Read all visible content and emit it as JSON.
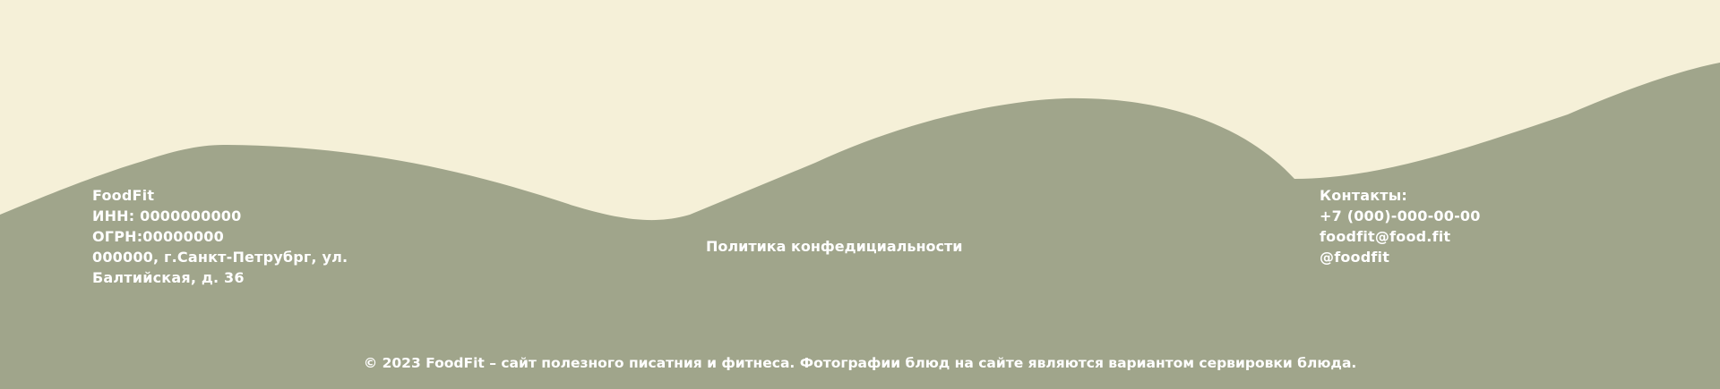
{
  "company": {
    "name": "FoodFit",
    "inn": "ИНН: 0000000000",
    "ogrn": "ОГРН:00000000",
    "address_line1": "000000, г.Санкт-Петрубрг, ул.",
    "address_line2": "Балтийская, д. 36"
  },
  "policy_link": "Политика конфедициальности",
  "contacts": {
    "title": "Контакты:",
    "phone": "+7 (000)-000-00-00",
    "email": "foodfit@food.fit",
    "social": "@foodfit"
  },
  "copyright": "© 2023 FoodFit – сайт полезного писатния и фитнеса. Фотографии блюд на сайте являются вариантом сервировки блюда.",
  "colors": {
    "background": "#f5f0d8",
    "footer": "#a0a58b",
    "text": "#ffffff"
  }
}
